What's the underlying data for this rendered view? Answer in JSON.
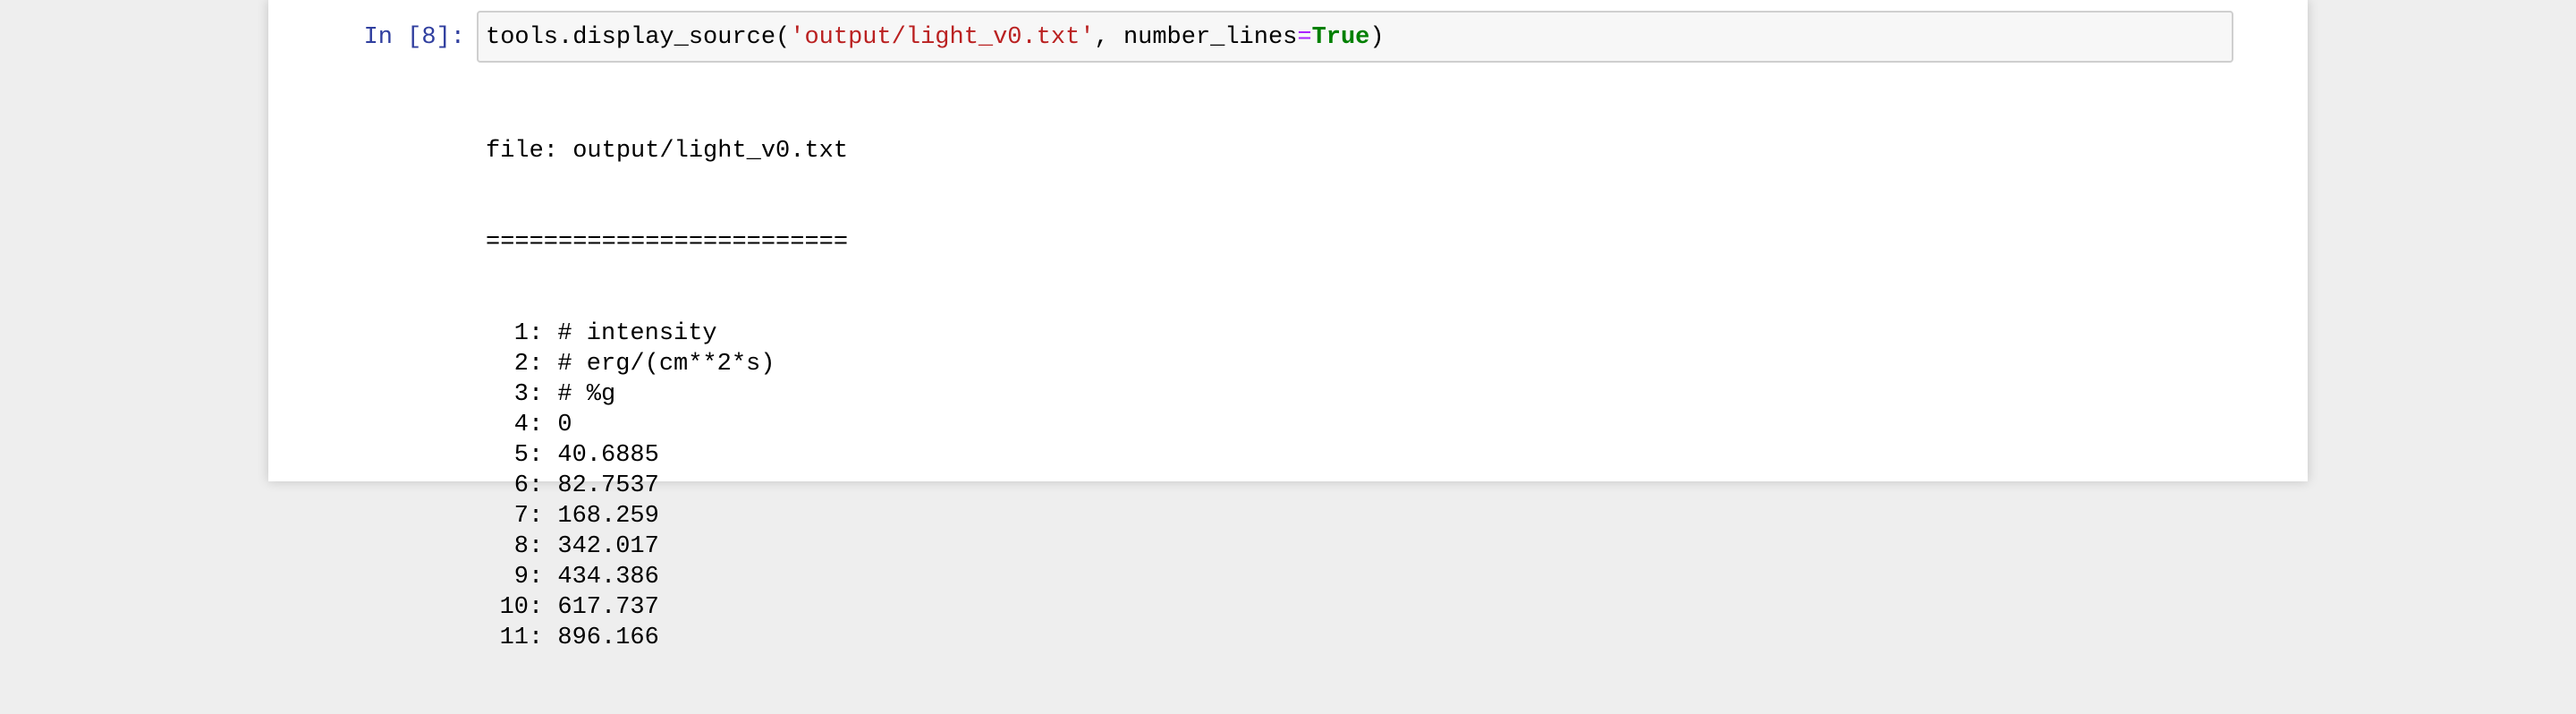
{
  "cell": {
    "prompt": "In [8]:",
    "code": {
      "func": "tools.display_source(",
      "string_arg": "'output/light_v0.txt'",
      "separator": ", ",
      "kwarg_name": "number_lines",
      "equals": "=",
      "kwarg_value": "True",
      "close": ")"
    }
  },
  "output": {
    "file_header": "file: output/light_v0.txt",
    "rule": "=========================",
    "lines": [
      {
        "num": "1",
        "text": "# intensity"
      },
      {
        "num": "2",
        "text": "# erg/(cm**2*s)"
      },
      {
        "num": "3",
        "text": "# %g"
      },
      {
        "num": "4",
        "text": "0"
      },
      {
        "num": "5",
        "text": "40.6885"
      },
      {
        "num": "6",
        "text": "82.7537"
      },
      {
        "num": "7",
        "text": "168.259"
      },
      {
        "num": "8",
        "text": "342.017"
      },
      {
        "num": "9",
        "text": "434.386"
      },
      {
        "num": "10",
        "text": "617.737"
      },
      {
        "num": "11",
        "text": "896.166"
      }
    ]
  },
  "colors": {
    "prompt": "#303f9f",
    "string": "#ba2121",
    "operator": "#aa22ff",
    "keyword": "#008000"
  }
}
